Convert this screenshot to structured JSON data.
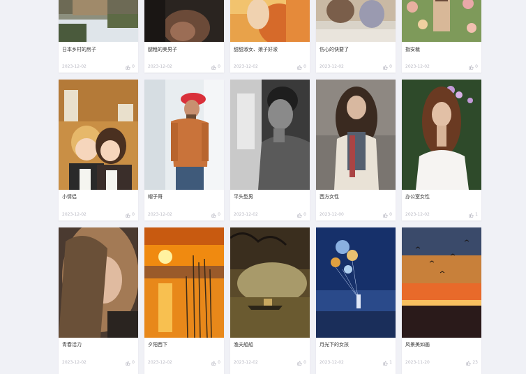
{
  "cards": [
    {
      "title": "日本乡村的房子",
      "date": "2023-12-02",
      "likes": "0",
      "icon": "thumb-up-icon"
    },
    {
      "title": "腿粗的美男子",
      "date": "2023-12-02",
      "likes": "0",
      "icon": "thumb-up-icon"
    },
    {
      "title": "甜甜淑女、娘子好滚",
      "date": "2023-12-02",
      "likes": "0",
      "icon": "thumb-up-icon"
    },
    {
      "title": "伤心的快要了",
      "date": "2023-12-02",
      "likes": "0",
      "icon": "thumb-up-icon"
    },
    {
      "title": "指安裁",
      "date": "2023-12-02",
      "likes": "0",
      "icon": "thumb-up-icon"
    },
    {
      "title": "小情侣",
      "date": "2023-12-02",
      "likes": "0",
      "icon": "thumb-up-icon"
    },
    {
      "title": "帽子哥",
      "date": "2023-12-02",
      "likes": "0",
      "icon": "thumb-up-icon"
    },
    {
      "title": "平头型男",
      "date": "2023-12-02",
      "likes": "0",
      "icon": "thumb-up-icon"
    },
    {
      "title": "西方女性",
      "date": "2023-12-00",
      "likes": "0",
      "icon": "thumb-up-icon"
    },
    {
      "title": "办公室女性",
      "date": "2023-12-02",
      "likes": "1",
      "icon": "thumb-up-icon"
    },
    {
      "title": "青春活力",
      "date": "2023-12-02",
      "likes": "0",
      "icon": "thumb-up-icon"
    },
    {
      "title": "夕阳西下",
      "date": "2023-12-02",
      "likes": "0",
      "icon": "thumb-up-icon"
    },
    {
      "title": "渔夫船船",
      "date": "2023-12-02",
      "likes": "0",
      "icon": "thumb-up-icon"
    },
    {
      "title": "月光下的女孩",
      "date": "2023-12-02",
      "likes": "1",
      "icon": "thumb-up-icon"
    },
    {
      "title": "风景美如画",
      "date": "2023-11-20",
      "likes": "23",
      "icon": "thumb-up-icon"
    }
  ],
  "colors": {
    "page_bg": "#f0f1f6",
    "card_bg": "#ffffff",
    "meta_text": "#b9b9c3",
    "title_text": "#333333"
  }
}
